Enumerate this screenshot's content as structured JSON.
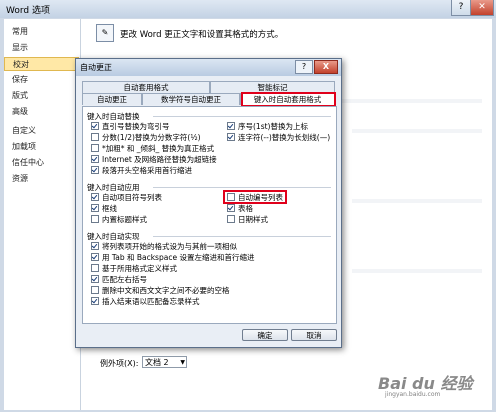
{
  "outer": {
    "title": "Word 选项",
    "header_text": "更改 Word 更正文字和设置其格式的方式。",
    "nav": [
      "常用",
      "显示",
      "校对",
      "保存",
      "版式",
      "高级",
      "自定义",
      "加载项",
      "信任中心",
      "资源"
    ],
    "nav_selected_index": 2,
    "example_label": "例外项(X):",
    "example_value": "文档 2"
  },
  "dialog": {
    "title": "自动更正",
    "help": "?",
    "close": "X",
    "tabs_top": [
      "自动套用格式",
      "智能标记"
    ],
    "tabs_bottom": [
      "自动更正",
      "数学符号自动更正",
      "键入时自动套用格式"
    ],
    "active_tab": "键入时自动套用格式",
    "sections": [
      {
        "title": "键入时自动替换",
        "items": [
          {
            "label": "直引号替换为弯引号",
            "checked": true
          },
          {
            "label": "序号(1st)替换为上标",
            "checked": true
          },
          {
            "label": "分数(1/2)替换为分数字符(½)",
            "checked": false
          },
          {
            "label": "连字符(--)替换为长划线(—)",
            "checked": true
          },
          {
            "label": "*加粗* 和 _倾斜_ 替换为真正格式",
            "checked": false
          },
          {
            "label": "Internet 及网络路径替换为超链接",
            "checked": true
          },
          {
            "label": "段落开头空格采用首行缩进",
            "checked": true
          }
        ]
      },
      {
        "title": "键入时自动应用",
        "items": [
          {
            "label": "自动项目符号列表",
            "checked": true
          },
          {
            "label": "自动编号列表",
            "checked": false
          },
          {
            "label": "框线",
            "checked": true
          },
          {
            "label": "表格",
            "checked": true
          },
          {
            "label": "内置标题样式",
            "checked": false
          },
          {
            "label": "日期样式",
            "checked": false
          }
        ]
      },
      {
        "title": "键入时自动实现",
        "items": [
          {
            "label": "将列表项开始的格式设为与其前一项相似",
            "checked": true
          },
          {
            "label": "用 Tab 和 Backspace 设置左缩进和首行缩进",
            "checked": true
          },
          {
            "label": "基于所用格式定义样式",
            "checked": false
          },
          {
            "label": "匹配左右括号",
            "checked": true
          },
          {
            "label": "删除中文和西文文字之间不必要的空格",
            "checked": false
          },
          {
            "label": "插入结束语以匹配备忘录样式",
            "checked": true
          }
        ]
      }
    ],
    "ok": "确定",
    "cancel": "取消"
  },
  "watermark": "Bai du 经验",
  "watermark_sub": "jingyan.baidu.com"
}
